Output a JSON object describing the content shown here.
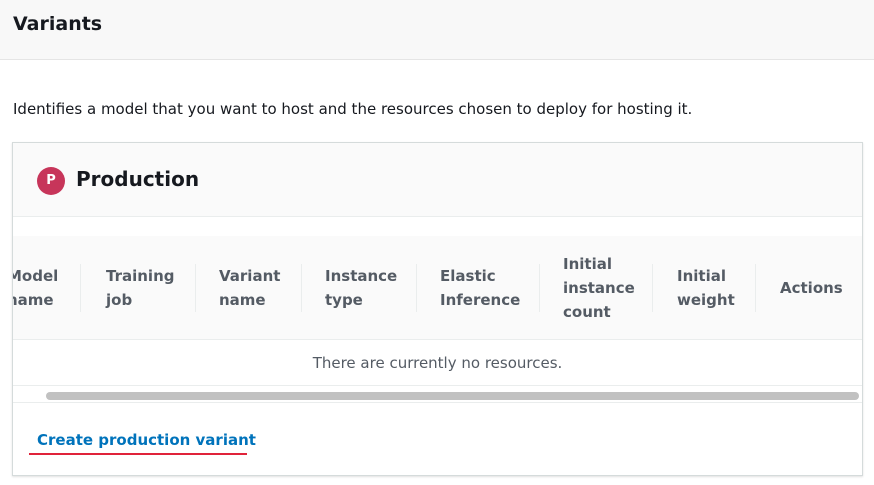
{
  "section": {
    "title": "Variants",
    "description": "Identifies a model that you want to host and the resources chosen to deploy for hosting it."
  },
  "production": {
    "badge": "P",
    "title": "Production",
    "badge_color": "#c7355a",
    "columns": [
      "Model\nname",
      "Training\njob",
      "Variant\nname",
      "Instance\ntype",
      "Elastic\nInference",
      "Initial\ninstance\ncount",
      "Initial\nweight",
      "Actions"
    ],
    "empty_message": "There are currently no resources.",
    "create_link": "Create production variant",
    "link_color": "#0073bb"
  }
}
